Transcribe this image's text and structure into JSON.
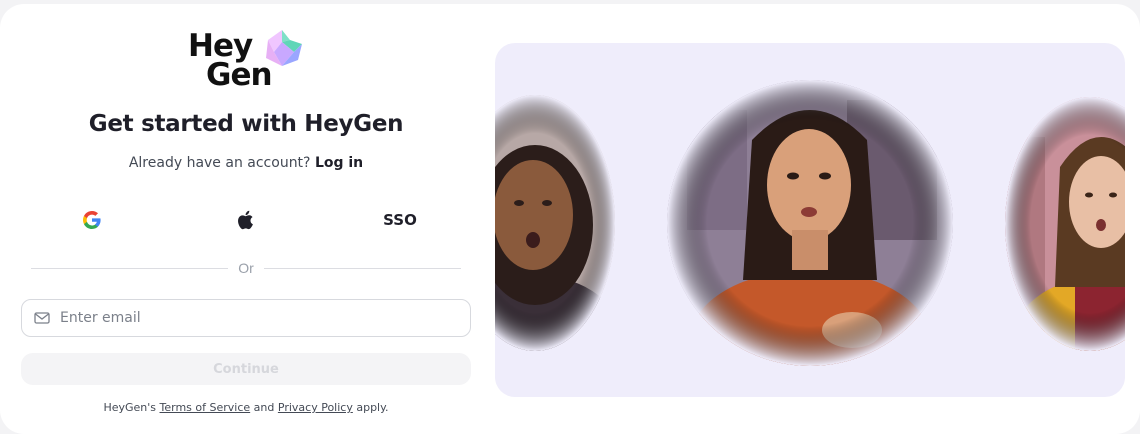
{
  "brand": {
    "line1": "Hey",
    "line2": "Gen"
  },
  "title": "Get started with HeyGen",
  "signin": {
    "prompt": "Already have an account?",
    "link": "Log in"
  },
  "social": {
    "google_icon": "google-logo-icon",
    "apple_icon": "apple-logo-icon",
    "sso_label": "SSO"
  },
  "divider_label": "Or",
  "email": {
    "icon": "mail-icon",
    "placeholder": "Enter email",
    "value": ""
  },
  "continue_label": "Continue",
  "terms": {
    "prefix": "HeyGen's",
    "tos": "Terms of Service",
    "and": "and",
    "privacy": "Privacy Policy",
    "suffix": "apply."
  },
  "colors": {
    "accent_panel": "#efedfb",
    "continue_bg": "#f4f4f6",
    "continue_text": "#d6d7dc"
  },
  "avatars": [
    "avatar-woman-left",
    "avatar-woman-center",
    "avatar-woman-right"
  ]
}
